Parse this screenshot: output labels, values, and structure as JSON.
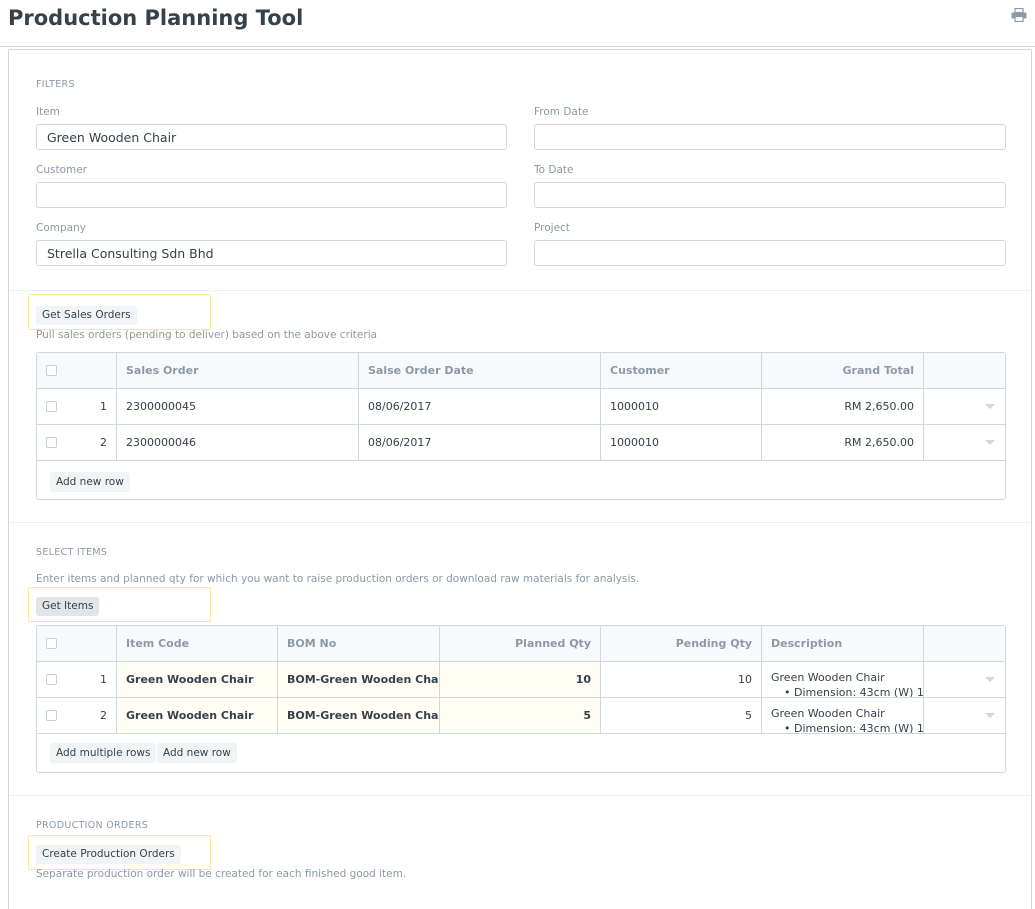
{
  "page": {
    "title": "Production Planning Tool"
  },
  "filters": {
    "section_title": "FILTERS",
    "item_label": "Item",
    "item_value": "Green Wooden Chair",
    "from_date_label": "From Date",
    "from_date_value": "",
    "customer_label": "Customer",
    "customer_value": "",
    "to_date_label": "To Date",
    "to_date_value": "",
    "company_label": "Company",
    "company_value": "Strella Consulting Sdn Bhd",
    "project_label": "Project",
    "project_value": ""
  },
  "sales_orders": {
    "button": "Get Sales Orders",
    "help": "Pull sales orders (pending to deliver) based on the above criteria",
    "columns": [
      "Sales Order",
      "Salse Order Date",
      "Customer",
      "Grand Total"
    ],
    "rows": [
      {
        "idx": "1",
        "sales_order": "2300000045",
        "date": "08/06/2017",
        "customer": "1000010",
        "grand_total": "RM 2,650.00"
      },
      {
        "idx": "2",
        "sales_order": "2300000046",
        "date": "08/06/2017",
        "customer": "1000010",
        "grand_total": "RM 2,650.00"
      }
    ],
    "add_row": "Add new row"
  },
  "select_items": {
    "section_title": "SELECT ITEMS",
    "help": "Enter items and planned qty for which you want to raise production orders or download raw materials for analysis.",
    "button": "Get Items",
    "columns": [
      "Item Code",
      "BOM No",
      "Planned Qty",
      "Pending Qty",
      "Description"
    ],
    "rows": [
      {
        "idx": "1",
        "item_code": "Green Wooden Chair",
        "bom_no": "BOM-Green Wooden Chai...",
        "planned_qty": "10",
        "pending_qty": "10",
        "description": "Green Wooden Chair",
        "description_bullet": "Dimension: 43cm (W) 1"
      },
      {
        "idx": "2",
        "item_code": "Green Wooden Chair",
        "bom_no": "BOM-Green Wooden Chai...",
        "planned_qty": "5",
        "pending_qty": "5",
        "description": "Green Wooden Chair",
        "description_bullet": "Dimension: 43cm (W) 1"
      }
    ],
    "add_multiple": "Add multiple rows",
    "add_row": "Add new row"
  },
  "production_orders": {
    "section_title": "PRODUCTION ORDERS",
    "button": "Create Production Orders",
    "help": "Separate production order will be created for each finished good item."
  },
  "icons": {
    "print": "print-icon",
    "row_menu": "chevron-down-icon"
  }
}
